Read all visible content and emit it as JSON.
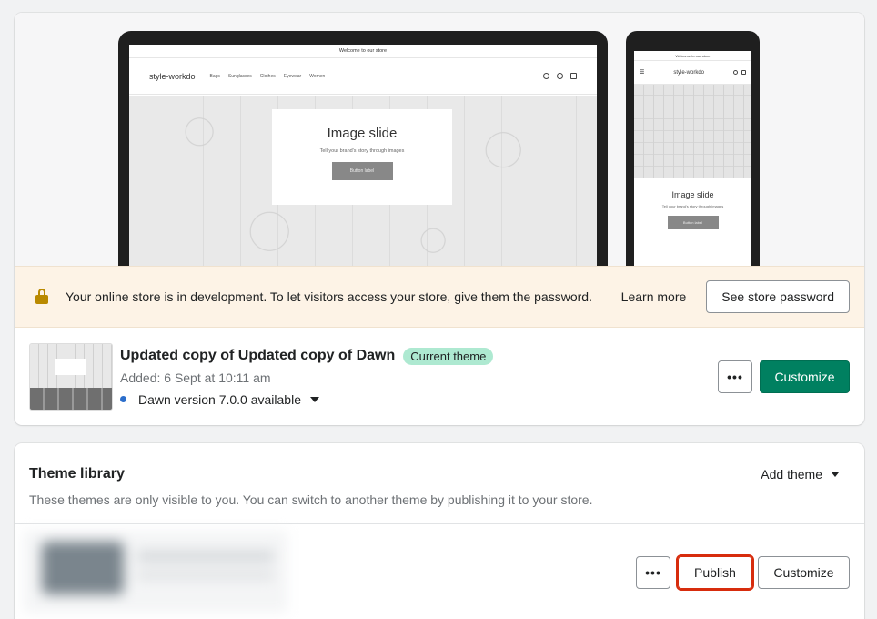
{
  "preview": {
    "desktop": {
      "announcement": "Welcome to our store",
      "logo": "style-workdo",
      "nav": [
        "Bags",
        "Sunglasses",
        "Clothes",
        "Eyewear",
        "Women"
      ],
      "hero_title": "Image slide",
      "hero_subtitle": "Tell your brand's story through images",
      "hero_button": "Button label"
    },
    "mobile": {
      "announcement": "Welcome to our store",
      "logo": "style-workdo",
      "hero_title": "Image slide",
      "hero_subtitle": "Tell your brand's story through images",
      "hero_button": "Button label"
    }
  },
  "banner": {
    "icon": "lock-icon",
    "message": "Your online store is in development. To let visitors access your store, give them the password.",
    "learn_more": "Learn more",
    "password_button": "See store password",
    "background": "#fdf3e6"
  },
  "current_theme": {
    "name": "Updated copy of Updated copy of Dawn",
    "badge": "Current theme",
    "added": "Added: 6 Sept at 10:11 am",
    "version": "Dawn version 7.0.0 available",
    "more_label": "•••",
    "customize_label": "Customize",
    "accent": "#008060"
  },
  "library": {
    "title": "Theme library",
    "add_theme": "Add theme",
    "description": "These themes are only visible to you. You can switch to another theme by publishing it to your store.",
    "more_label": "•••",
    "publish_label": "Publish",
    "customize_label": "Customize",
    "highlight": "#d72c0d"
  }
}
